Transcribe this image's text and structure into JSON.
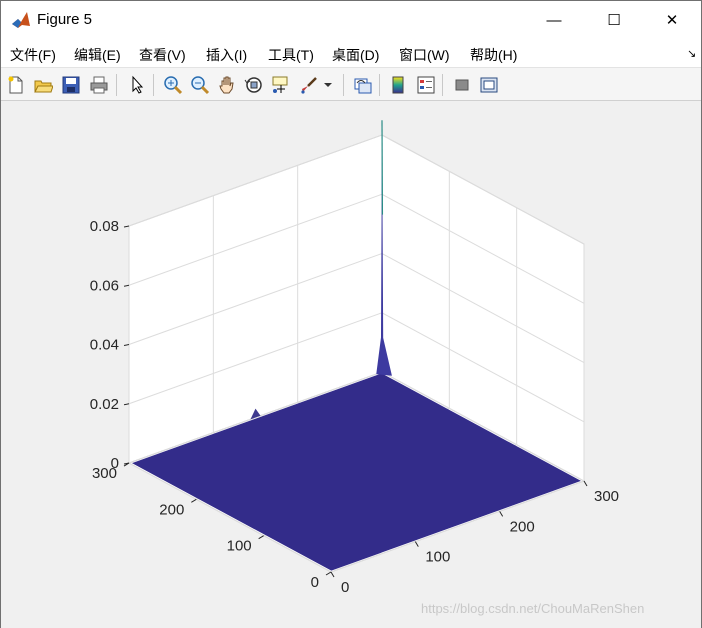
{
  "window": {
    "title": "Figure 5",
    "minimize_symbol": "—",
    "maximize_symbol": "☐",
    "close_symbol": "✕"
  },
  "menu": {
    "items": [
      "文件(F)",
      "编辑(E)",
      "查看(V)",
      "插入(I)",
      "工具(T)",
      "桌面(D)",
      "窗口(W)",
      "帮助(H)"
    ],
    "overflow_symbol": "↘"
  },
  "toolbar": {
    "icons": [
      "new-figure-icon",
      "open-icon",
      "save-icon",
      "print-icon",
      "pointer-icon",
      "zoom-in-icon",
      "zoom-out-icon",
      "pan-icon",
      "rotate-3d-icon",
      "data-cursor-icon",
      "brush-icon",
      "link-plot-icon",
      "colorbar-icon",
      "legend-icon",
      "hide-plot-tools-icon",
      "show-plot-tools-icon"
    ]
  },
  "chart_data": {
    "type": "surface",
    "title": "",
    "xlabel": "",
    "ylabel": "",
    "zlabel": "",
    "xlim": [
      0,
      300
    ],
    "ylim": [
      0,
      300
    ],
    "zlim": [
      0,
      0.08
    ],
    "x_ticks": [
      "0",
      "100",
      "200",
      "300"
    ],
    "y_ticks": [
      "0",
      "100",
      "200",
      "300"
    ],
    "z_ticks": [
      "0",
      "0.02",
      "0.04",
      "0.06",
      "0.08"
    ],
    "grid": true,
    "surface_color": "#332c8a",
    "peak": {
      "x": 300,
      "y": 300,
      "z": 0.085
    },
    "secondary_bump": {
      "x": 150,
      "y": 300,
      "z": 0.003
    },
    "view": "default 3-D (azimuth -37.5, elevation 30)"
  },
  "colors": {
    "figure_background": "#f0f0f0",
    "axes_background": "#ffffff",
    "grid": "#dcdcdc",
    "surface": "#332c8a",
    "peak_highlight": "#2a8c86"
  },
  "watermark": "https://blog.csdn.net/ChouMaRenShen"
}
